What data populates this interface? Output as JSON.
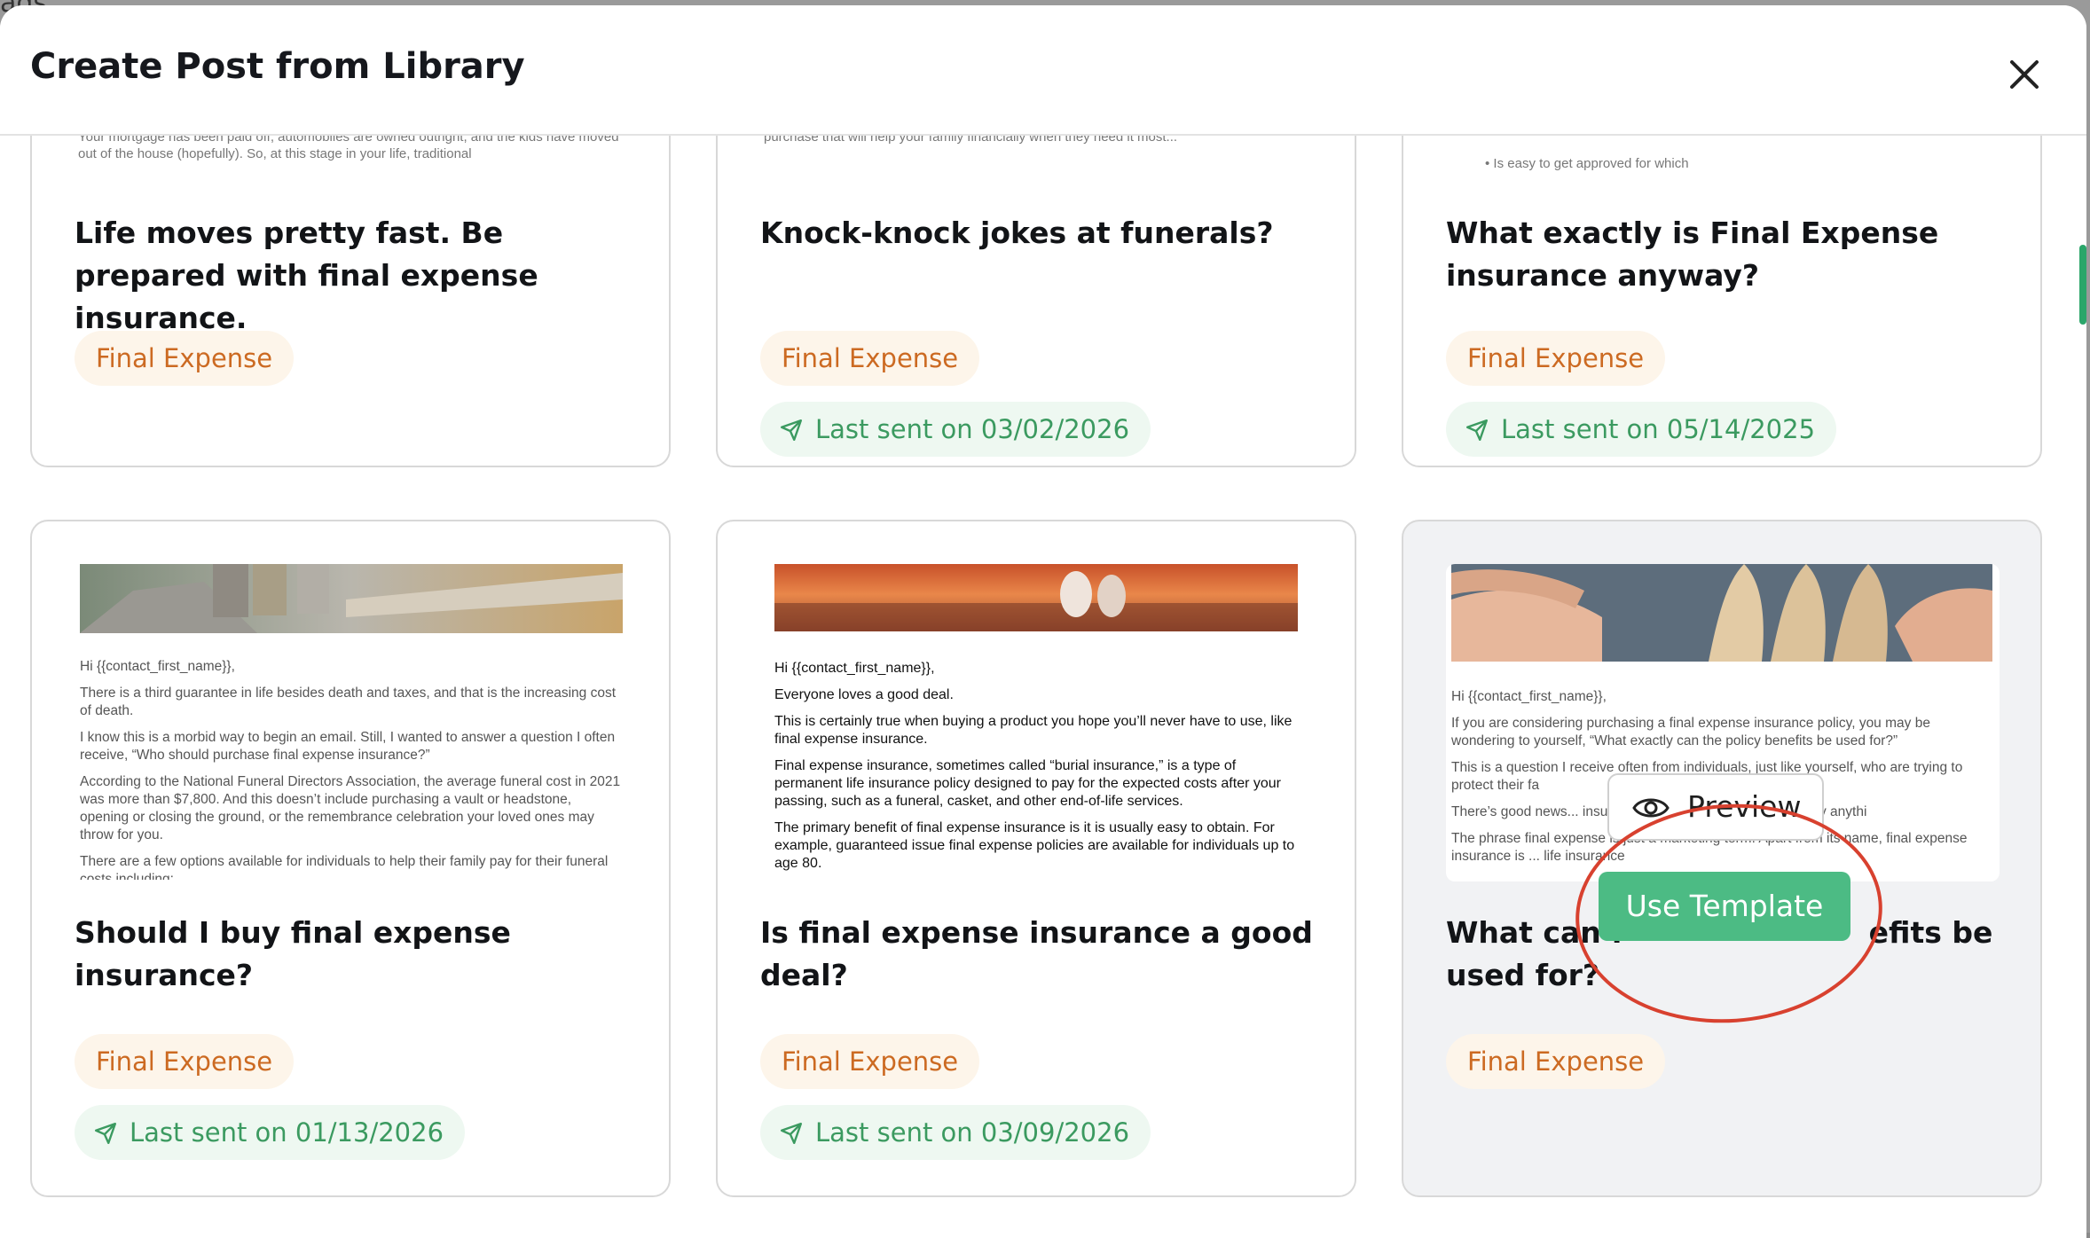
{
  "behind": {
    "text": "ads"
  },
  "modal": {
    "title": "Create Post from Library",
    "close_label": "×"
  },
  "cards": [
    {
      "title": "Life moves pretty fast. Be prepared with final expense insurance.",
      "tag": "Final Expense",
      "last_sent": "",
      "preview_snippet": "Your mortgage has been paid off, automobiles are owned outright, and the kids have moved out of the house (hopefully). So, at this stage in your life, traditional"
    },
    {
      "title": "Knock-knock jokes at funerals?",
      "tag": "Final Expense",
      "last_sent": "Last sent on 03/02/2026",
      "preview_snippet": "purchase that will help your family financially when they need it most..."
    },
    {
      "title": "What exactly is Final Expense insurance anyway?",
      "tag": "Final Expense",
      "last_sent": "Last sent on 05/14/2025",
      "preview_snippet": "• Is easy to get approved for which"
    },
    {
      "title": "Should I buy final expense insurance?",
      "tag": "Final Expense",
      "last_sent": "Last sent on 01/13/2026",
      "preview_paragraphs": [
        "Hi {{contact_first_name}},",
        "There is a third guarantee in life besides death and taxes, and that is the increasing cost of death.",
        "I know this is a morbid way to begin an email. Still, I wanted to answer a question I often receive, “Who should purchase final expense insurance?”",
        "According to the National Funeral Directors Association, the average funeral cost in 2021 was more than $7,800. And this doesn’t include purchasing a vault or headstone, opening or closing the ground, or the remembrance celebration your loved ones may throw for you.",
        "There are a few options available for individuals to help their family pay for their funeral costs including:"
      ]
    },
    {
      "title": "Is final expense insurance a good deal?",
      "tag": "Final Expense",
      "last_sent": "Last sent on 03/09/2026",
      "preview_paragraphs": [
        "Hi {{contact_first_name}},",
        "Everyone loves a good deal.",
        "This is certainly true when buying a product you hope you’ll never have to use, like final expense insurance.",
        "Final expense insurance, sometimes called “burial insurance,” is a type of permanent life insurance policy designed to pay for the expected costs after your passing, such as a funeral, casket, and other end-of-life services.",
        "The primary benefit of final expense insurance is it is usually easy to obtain. For example, guaranteed issue final expense policies are available for individuals up to age 80."
      ]
    },
    {
      "title": "What can final expense policy benefits be used for?",
      "title_visible": [
        "What can f",
        "efits be",
        "used for?"
      ],
      "tag": "Final Expense",
      "last_sent": "",
      "preview_paragraphs": [
        "Hi {{contact_first_name}},",
        "If you are considering purchasing a final expense insurance policy, you may be wondering to yourself, “What exactly can the policy benefits be used for?”",
        "This is a question I receive often from individuals, just like yourself, who are trying to protect their fa",
        "There’s good news... insurance policy can be used for literally anythi",
        "The phrase final expense is just a marketing term. Apart from its name, final expense insurance is ... life insurance"
      ],
      "hover": {
        "preview_label": "Preview",
        "use_template_label": "Use Template"
      }
    }
  ],
  "colors": {
    "tag_bg": "#fdf5ea",
    "tag_text": "#cc6a22",
    "sent_bg": "#eef8f1",
    "sent_text": "#3b9a60",
    "use_template_bg": "#4cbb84",
    "annotation_circle": "#d8412f"
  },
  "icons": {
    "close": "close-icon",
    "sent": "send-icon",
    "preview": "eye-icon"
  }
}
